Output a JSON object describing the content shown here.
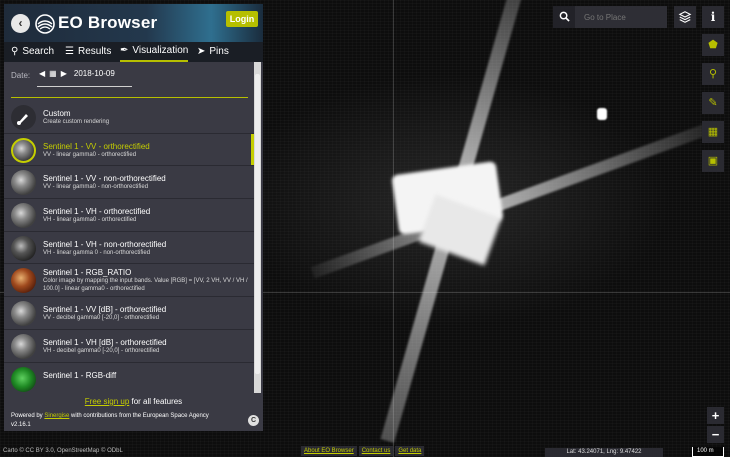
{
  "app": {
    "title": "EO Browser",
    "login_label": "Login"
  },
  "tabs": [
    {
      "label": "Search",
      "icon": "search-icon"
    },
    {
      "label": "Results",
      "icon": "list-icon"
    },
    {
      "label": "Visualization",
      "icon": "brush-icon"
    },
    {
      "label": "Pins",
      "icon": "pin-icon"
    }
  ],
  "date": {
    "label": "Date:",
    "value": "2018-10-09"
  },
  "layers": [
    {
      "title": "Custom",
      "desc": "Create custom rendering"
    },
    {
      "title": "Sentinel 1 - VV - orthorectified",
      "desc": "VV - linear gamma0 - orthorectified"
    },
    {
      "title": "Sentinel 1 - VV - non-orthorectified",
      "desc": "VV - linear gamma0 - non-orthorectified"
    },
    {
      "title": "Sentinel 1 - VH - orthorectified",
      "desc": "VH - linear gamma0 - orthorectified"
    },
    {
      "title": "Sentinel 1 - VH - non-orthorectified",
      "desc": "VH - linear gamma 0 - non-orthorectified"
    },
    {
      "title": "Sentinel 1 - RGB_RATIO",
      "desc": "Color image by mapping the input bands. Value [RGB] = [VV, 2 VH, VV / VH / 100.0] - linear gamma0 - orthorectified"
    },
    {
      "title": "Sentinel 1 - VV [dB] - orthorectified",
      "desc": "VV - decibel gamma0 [-20,0] - orthorectified"
    },
    {
      "title": "Sentinel 1 - VH [dB] - orthorectified",
      "desc": "VH - decibel gamma0 [-20,0] - orthorectified"
    },
    {
      "title": "Sentinel 1 - RGB-diff",
      "desc": ""
    }
  ],
  "footer": {
    "signup_link": "Free sign up",
    "signup_rest": " for all features",
    "powered_prefix": "Powered by ",
    "powered_link": "Sinergise",
    "powered_suffix": " with contributions from the European Space Agency",
    "version": "v2.16.1"
  },
  "search": {
    "placeholder": "Go to Place"
  },
  "bottom": {
    "attribution": "Carto © CC BY 3.0, OpenStreetMap © ODbL",
    "links": [
      "About EO Browser",
      "Contact us",
      "Get data"
    ],
    "coords": "Lat: 43.24071, Lng: 9.47422",
    "scale": "100 m"
  },
  "colors": {
    "accent": "#b6bf00",
    "panel": "#3a3a44"
  }
}
